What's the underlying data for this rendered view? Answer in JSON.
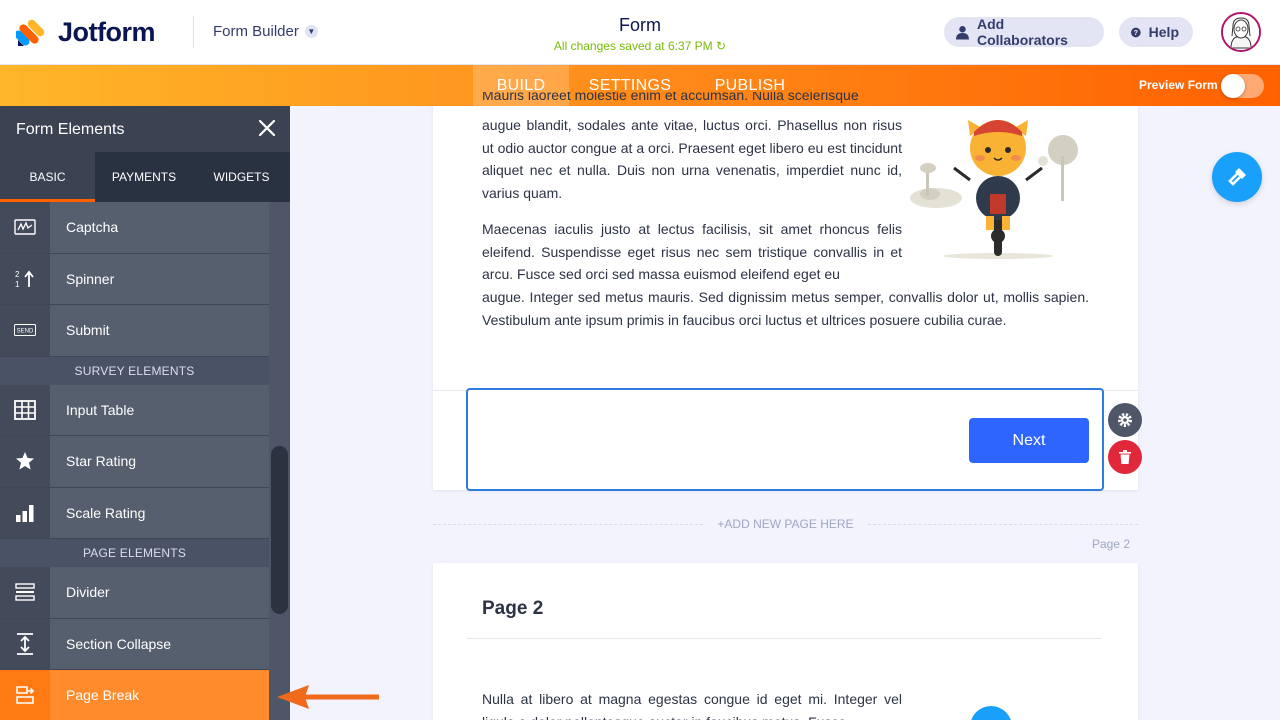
{
  "header": {
    "brand": "Jotform",
    "builder_label": "Form Builder",
    "form_title": "Form",
    "save_status": "All changes saved at 6:37 PM",
    "collab_label": "Add Collaborators",
    "help_label": "Help"
  },
  "nav": {
    "tabs": [
      "BUILD",
      "SETTINGS",
      "PUBLISH"
    ],
    "active_tab": "BUILD",
    "preview_label": "Preview Form",
    "preview_on": false
  },
  "sidebar": {
    "title": "Form Elements",
    "tabs": [
      "BASIC",
      "PAYMENTS",
      "WIDGETS"
    ],
    "items_top": [
      {
        "label": "Captcha",
        "icon": "captcha-icon"
      },
      {
        "label": "Spinner",
        "icon": "spinner-icon"
      },
      {
        "label": "Submit",
        "icon": "submit-icon"
      }
    ],
    "survey_section": "SURVEY ELEMENTS",
    "survey_items": [
      {
        "label": "Input Table",
        "icon": "table-icon"
      },
      {
        "label": "Star Rating",
        "icon": "star-icon"
      },
      {
        "label": "Scale Rating",
        "icon": "bar-chart-icon"
      }
    ],
    "page_section": "PAGE ELEMENTS",
    "page_items": [
      {
        "label": "Divider",
        "icon": "divider-icon"
      },
      {
        "label": "Section Collapse",
        "icon": "collapse-icon"
      },
      {
        "label": "Page Break",
        "icon": "page-break-icon"
      }
    ]
  },
  "content": {
    "para1_top_partial": "Mauris laoreet molestie enim et accumsan. Nulla scelerisque",
    "para1": "augue blandit, sodales ante vitae, luctus orci. Phasellus non risus ut odio auctor congue at a orci. Praesent eget libero eu est tincidunt aliquet nec et nulla. Duis non urna venenatis, imperdiet nunc id, varius quam.",
    "para2_narrow": "Maecenas iaculis justo at lectus facilisis, sit amet rhoncus felis eleifend. Suspendisse eget risus nec sem tristique convallis in et arcu. Fusce sed orci sed massa euismod eleifend eget eu",
    "para2_wide": "augue. Integer sed metus mauris. Sed dignissim metus semper, convallis dolor ut, mollis sapien. Vestibulum ante ipsum primis in faucibus orci luctus et ultrices posuere cubilia curae.",
    "next_button": "Next",
    "add_page": "+ADD NEW PAGE HERE",
    "page_label": "Page 2",
    "page2_title": "Page 2",
    "page2_para": "Nulla at libero at magna egestas congue id eget mi. Integer vel ligula a dolor pellentesque auctor in faucibus metus. Fusce"
  },
  "colors": {
    "brand_orange": "#ff6100",
    "accent_blue": "#2f65ff",
    "save_green": "#78bb07",
    "delete_red": "#e0283a"
  }
}
